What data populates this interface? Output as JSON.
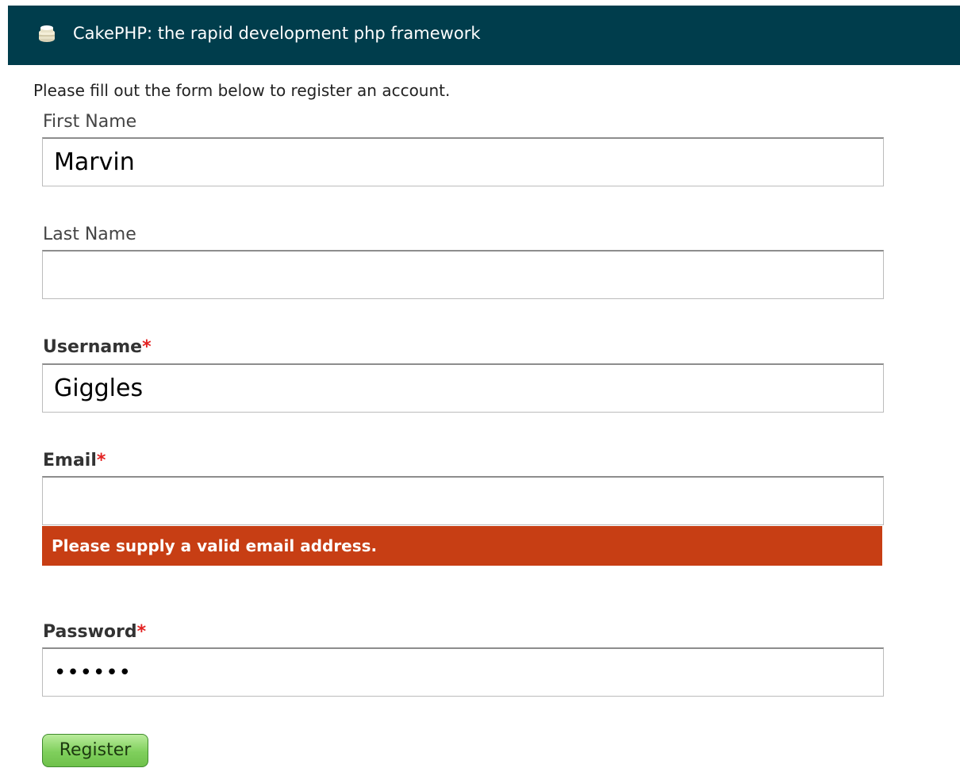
{
  "header": {
    "icon": "cake-stack-icon",
    "title": "CakePHP: the rapid development php framework",
    "background": "#003d4c"
  },
  "form": {
    "intro": "Please fill out the form below to register an account.",
    "fields": {
      "first_name": {
        "label": "First Name",
        "value": "Marvin",
        "required": false
      },
      "last_name": {
        "label": "Last Name",
        "value": "",
        "required": false
      },
      "username": {
        "label": "Username",
        "value": "Giggles",
        "required": true
      },
      "email": {
        "label": "Email",
        "value": "",
        "required": true,
        "error": "Please supply a valid email address."
      },
      "password": {
        "label": "Password",
        "value": "••••••",
        "required": true
      }
    },
    "required_marker": "*",
    "submit_label": "Register",
    "error_color": "#c73e14",
    "required_color": "#e32222"
  }
}
